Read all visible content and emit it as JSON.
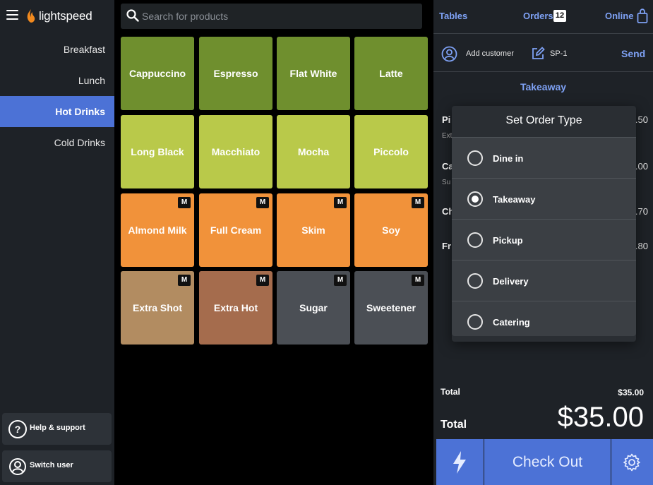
{
  "sidebar": {
    "logo_text": "lightspeed",
    "categories": [
      "Breakfast",
      "Lunch",
      "Hot Drinks",
      "Cold Drinks"
    ],
    "active_category": "Hot Drinks",
    "help_label": "Help & support",
    "switch_user_label": "Switch user"
  },
  "search": {
    "placeholder": "Search for products"
  },
  "products": [
    {
      "name": "Cappuccino",
      "color": "#6f8f2e",
      "modifier": ""
    },
    {
      "name": "Espresso",
      "color": "#6f8f2e",
      "modifier": ""
    },
    {
      "name": "Flat White",
      "color": "#6f8f2e",
      "modifier": ""
    },
    {
      "name": "Latte",
      "color": "#6f8f2e",
      "modifier": ""
    },
    {
      "name": "Long Black",
      "color": "#b9c94a",
      "modifier": ""
    },
    {
      "name": "Macchiato",
      "color": "#b9c94a",
      "modifier": ""
    },
    {
      "name": "Mocha",
      "color": "#b9c94a",
      "modifier": ""
    },
    {
      "name": "Piccolo",
      "color": "#b9c94a",
      "modifier": ""
    },
    {
      "name": "Almond Milk",
      "color": "#f1923a",
      "modifier": "M"
    },
    {
      "name": "Full Cream",
      "color": "#f1923a",
      "modifier": "M"
    },
    {
      "name": "Skim",
      "color": "#f1923a",
      "modifier": "M"
    },
    {
      "name": "Soy",
      "color": "#f1923a",
      "modifier": "M"
    },
    {
      "name": "Extra Shot",
      "color": "#b28c61",
      "modifier": "M"
    },
    {
      "name": "Extra Hot",
      "color": "#a56c4d",
      "modifier": "M"
    },
    {
      "name": "Sugar",
      "color": "#4b4f55",
      "modifier": "M"
    },
    {
      "name": "Sweetener",
      "color": "#4b4f55",
      "modifier": "M"
    }
  ],
  "order": {
    "tables_label": "Tables",
    "orders_label": "Orders",
    "orders_count": "12",
    "online_label": "Online",
    "add_customer_label": "Add customer",
    "order_id": "SP-1",
    "send_label": "Send",
    "order_type": "Takeaway",
    "lines": [
      {
        "name": "Pi",
        "sub": "Ext",
        "price": ".50"
      },
      {
        "name": "Ca",
        "sub": "Su",
        "price": ".00"
      },
      {
        "name": "Ch",
        "sub": "",
        "price": ".70"
      },
      {
        "name": "Fr",
        "sub": "",
        "price": ".80"
      }
    ],
    "total_label": "Total",
    "total_small": "$35.00",
    "total_big": "$35.00",
    "checkout_label": "Check Out"
  },
  "modal": {
    "title": "Set Order Type",
    "options": [
      "Dine in",
      "Takeaway",
      "Pickup",
      "Delivery",
      "Catering"
    ],
    "selected": "Takeaway"
  }
}
